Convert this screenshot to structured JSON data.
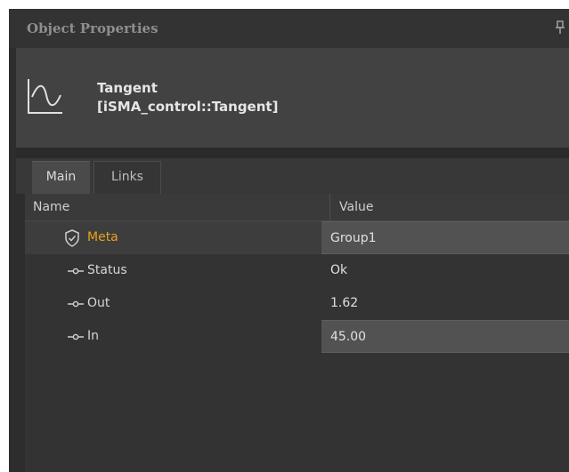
{
  "panel": {
    "title": "Object Properties",
    "pin_icon": "pin-icon"
  },
  "object": {
    "name": "Tangent",
    "type": "[iSMA_control::Tangent]",
    "icon": "tangent-wave-icon"
  },
  "tabs": [
    {
      "label": "Main",
      "active": true
    },
    {
      "label": "Links",
      "active": false
    }
  ],
  "table": {
    "headers": {
      "name": "Name",
      "value": "Value"
    },
    "rows": [
      {
        "icon": "shield-icon",
        "name": "Meta",
        "value": "Group1",
        "editable": true
      },
      {
        "icon": "slot-icon",
        "name": "Status",
        "value": "Ok",
        "editable": false
      },
      {
        "icon": "slot-icon",
        "name": "Out",
        "value": "1.62",
        "editable": false
      },
      {
        "icon": "slot-icon",
        "name": "In",
        "value": "45.00",
        "editable": true
      }
    ]
  },
  "colors": {
    "panel_bg": "#2d2d2d",
    "meta_label": "#e8a21a",
    "editable_cell": "#525252"
  }
}
